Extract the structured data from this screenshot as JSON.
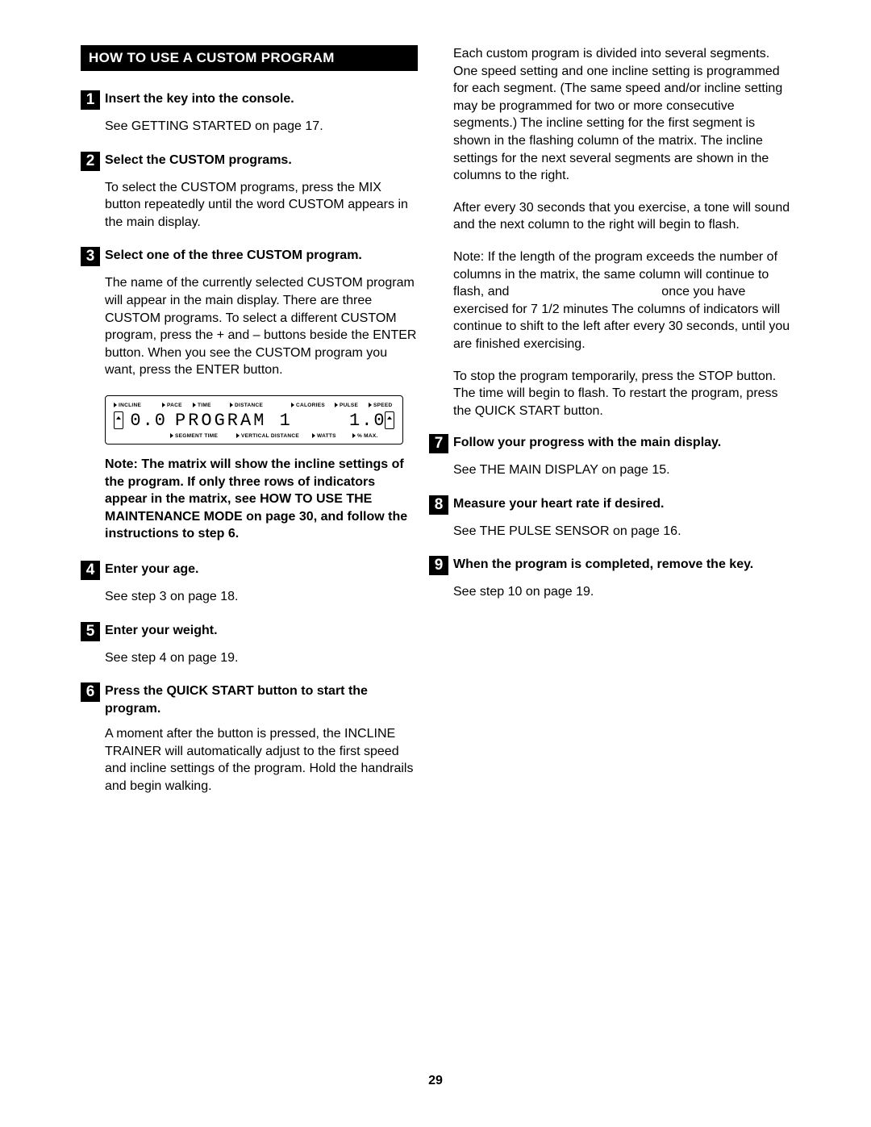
{
  "pageNumber": "29",
  "sectionHeader": "HOW TO USE A CUSTOM PROGRAM",
  "leftSteps": {
    "s1": {
      "num": "1",
      "title": "Insert the key into the console.",
      "body": "See GETTING STARTED on page 17."
    },
    "s2": {
      "num": "2",
      "title": "Select the CUSTOM programs.",
      "body": "To select the CUSTOM programs, press the MIX button repeatedly until the word CUSTOM appears in the main display."
    },
    "s3": {
      "num": "3",
      "title": "Select one of the three CUSTOM program.",
      "body": "The name of the currently selected CUSTOM program will appear in the main display. There are three CUSTOM programs. To select a different CUSTOM program, press the + and – buttons beside the ENTER button. When you see the CUSTOM program you want, press the ENTER button."
    },
    "s4": {
      "num": "4",
      "title": "Enter your age.",
      "body": "See step 3 on page 18."
    },
    "s5": {
      "num": "5",
      "title": "Enter your weight.",
      "body": "See step 4 on page 19."
    },
    "s6": {
      "num": "6",
      "title": "Press the QUICK START button to start the program.",
      "body": "A moment after the button is pressed, the INCLINE TRAINER will automatically adjust to the first speed and incline settings of the program. Hold the handrails and begin walking."
    }
  },
  "matrixNote": "Note: The matrix will show the incline settings of the program. If only three rows of indicators appear in the matrix, see HOW TO USE THE MAINTENANCE MODE on page 30, and follow the instructions to step 6.",
  "display": {
    "topLabels": {
      "incline": "INCLINE",
      "pace": "PACE",
      "time": "TIME",
      "distance": "DISTANCE",
      "calories": "CALORIES",
      "pulse": "PULSE",
      "speed": "SPEED"
    },
    "bottomLabels": {
      "segtime": "SEGMENT TIME",
      "vdist": "VERTICAL DISTANCE",
      "watts": "WATTS",
      "pmax": "% MAX."
    },
    "lcd": {
      "incline": "0.0",
      "main": "PROGRAM  1",
      "speed": "1.0"
    }
  },
  "rightContinuation": {
    "p1": "Each custom program is divided into several segments. One speed setting and one incline setting is programmed for each segment. (The same speed and/or incline setting may be programmed for two or more consecutive segments.) The incline setting for the first segment is shown in the flashing column of the matrix. The incline settings for the next several segments are shown in the columns to the right.",
    "p2": "After every 30 seconds that you exercise, a tone will sound and the next column to the right will begin to flash.",
    "p3a": "Note: If the length of the program exceeds the number of columns in the matrix, the same column will continue to flash, and",
    "p3b": "once you have exercised for 7 1/2 minutes  The columns of indicators will continue to shift to the left after every 30 seconds, until you are finished exercising.",
    "p4": "To stop the program temporarily, press the STOP button. The time will begin to flash. To restart the program, press the QUICK START button."
  },
  "rightSteps": {
    "s7": {
      "num": "7",
      "title": "Follow your progress with the main display.",
      "body": "See THE MAIN DISPLAY on page 15."
    },
    "s8": {
      "num": "8",
      "title": "Measure your heart rate if desired.",
      "body": "See THE PULSE SENSOR on page 16."
    },
    "s9": {
      "num": "9",
      "title": "When the program is completed, remove the key.",
      "body": "See step 10 on page 19."
    }
  }
}
